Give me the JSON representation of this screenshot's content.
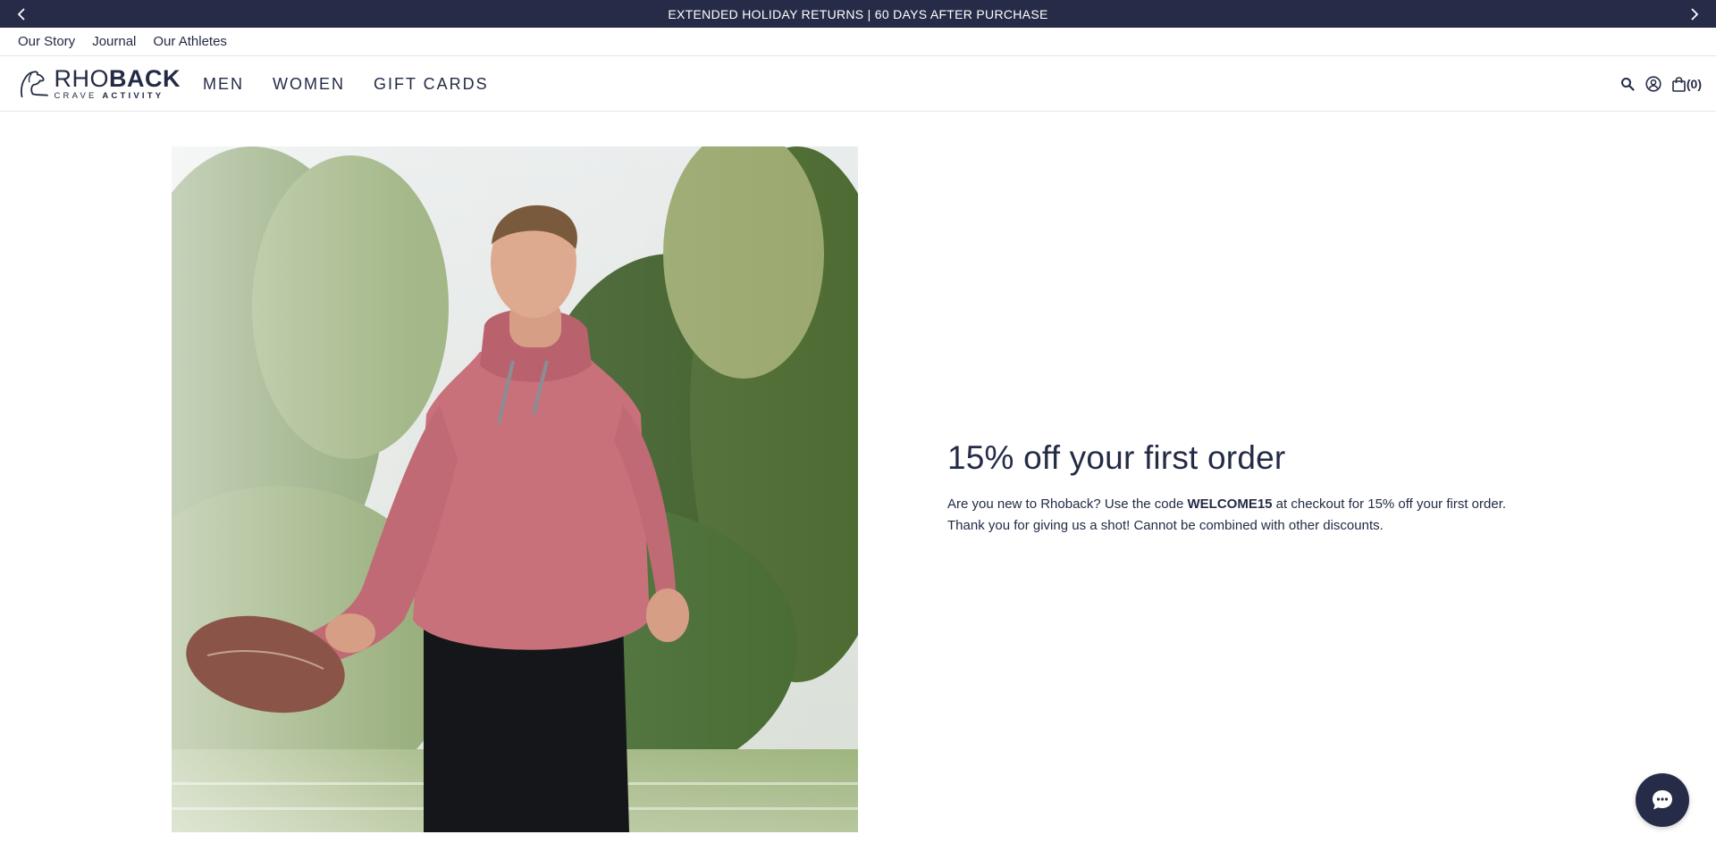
{
  "announcement": {
    "text": "EXTENDED HOLIDAY RETURNS | 60 DAYS AFTER PURCHASE",
    "prev_icon": "chevron-left-icon",
    "next_icon": "chevron-right-icon"
  },
  "utility_nav": {
    "items": [
      {
        "label": "Our Story"
      },
      {
        "label": "Journal"
      },
      {
        "label": "Our Athletes"
      }
    ]
  },
  "header": {
    "logo": {
      "main_light": "RHO",
      "main_bold": "BACK",
      "sub_light": "CRAVE ",
      "sub_bold": "ACTIVITY",
      "icon": "dog-head-logo-icon"
    },
    "nav": [
      {
        "label": "MEN"
      },
      {
        "label": "WOMEN"
      },
      {
        "label": "GIFT CARDS"
      }
    ],
    "icons": {
      "search": "search-icon",
      "account": "account-icon",
      "cart": "shopping-bag-icon"
    },
    "cart_count": "(0)"
  },
  "hero": {
    "image_alt": "Man in pink hoodie holding a football on a field",
    "title": "15% off your first order",
    "body_prefix": "Are you new to Rhoback? Use the code ",
    "code": "WELCOME15",
    "body_suffix": " at checkout for 15% off your first order.",
    "body_line2": "Thank you for giving us a shot! Cannot be combined with other discounts."
  },
  "chat": {
    "icon": "chat-bubble-icon"
  },
  "colors": {
    "navy": "#262c48",
    "text": "#232b46",
    "hoodie_pink": "#c8717b"
  }
}
